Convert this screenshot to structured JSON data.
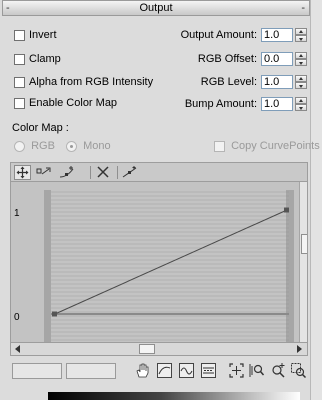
{
  "rollout": {
    "title": "Output",
    "left_marker": "-",
    "right_marker": "-"
  },
  "options": [
    {
      "label": "Invert"
    },
    {
      "label": "Clamp"
    },
    {
      "label": "Alpha from RGB Intensity"
    },
    {
      "label": "Enable Color Map"
    }
  ],
  "params": [
    {
      "label": "Output Amount:",
      "value": "1.0"
    },
    {
      "label": "RGB Offset:",
      "value": "0.0"
    },
    {
      "label": "RGB Level:",
      "value": "1.0"
    },
    {
      "label": "Bump Amount:",
      "value": "1.0"
    }
  ],
  "color_map": {
    "header": "Color Map :",
    "rgb_label": "RGB",
    "mono_label": "Mono",
    "copy_label": "Copy CurvePoints",
    "selected_mode": "Mono"
  },
  "graph": {
    "y_label_top": "1",
    "y_label_bottom": "0",
    "curve": {
      "start_value": 0.0,
      "end_value": 1.0
    }
  },
  "toolbar_icons": [
    "move-icon",
    "scale-point-icon",
    "add-point-icon",
    "delete-point-icon",
    "reset-curve-icon"
  ],
  "bottom_icons": [
    "pan-hand-icon",
    "zoom-extents-icon",
    "zoom-horizontal-icon",
    "zoom-vertical-icon",
    "zoom-region-icon",
    "zoom-icon",
    "zoom-add-icon",
    "zoom-window-icon"
  ],
  "colors": {
    "background": "#dcdcdc",
    "graph_bg": "#c3c3c3",
    "curve": "#4a4a4a"
  }
}
